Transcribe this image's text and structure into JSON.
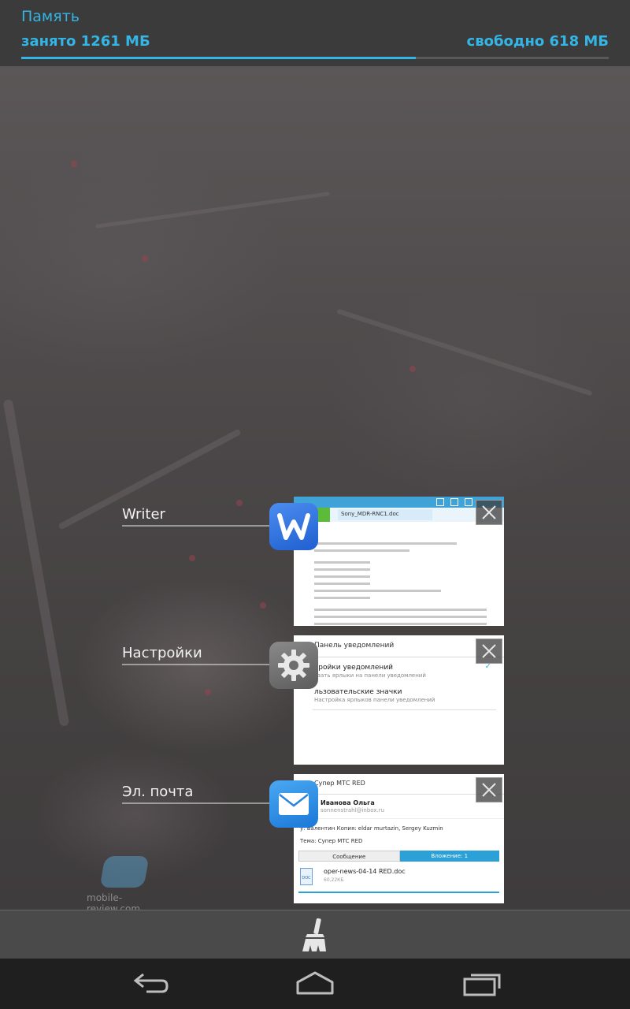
{
  "memory": {
    "title": "Память",
    "used_label": "занято 1261 МБ",
    "free_label": "свободно 618 МБ",
    "used_fraction": 0.671
  },
  "recent_apps": [
    {
      "name": "Writer",
      "icon": "writer-w-icon",
      "thumbnail": {
        "file_tab": "Sony_MDR-RNC1.doc"
      }
    },
    {
      "name": "Настройки",
      "icon": "gear-icon",
      "thumbnail": {
        "header": "Панель уведомлений",
        "item1_title": "тройки уведомлений",
        "item1_sub": "азать ярлыки на панели уведомлений",
        "item2_title": "льзовательские значки",
        "item2_sub": "Настройка ярлыков панели уведомлений"
      }
    },
    {
      "name": "Эл. почта",
      "icon": "mail-envelope-icon",
      "thumbnail": {
        "subject_header": "Супер МТС RED",
        "sender_name": "Иванова Ольга",
        "sender_email": "sonnenstrahl@inbox.ru",
        "to_line": "у: Валентин  Копия: eldar murtazin, Sergey Kuzmin",
        "subject_line": "Тема:  Супер МТС RED",
        "tab_message": "Сообщение",
        "tab_attachment": "Вложение: 1",
        "file_icon_label": "DOC",
        "file_name": "oper-news-04-14 RED.doc",
        "file_size": "60,22КБ"
      }
    }
  ],
  "watermark": {
    "text": "mobile-review.com"
  },
  "colors": {
    "accent": "#33b5e5"
  }
}
